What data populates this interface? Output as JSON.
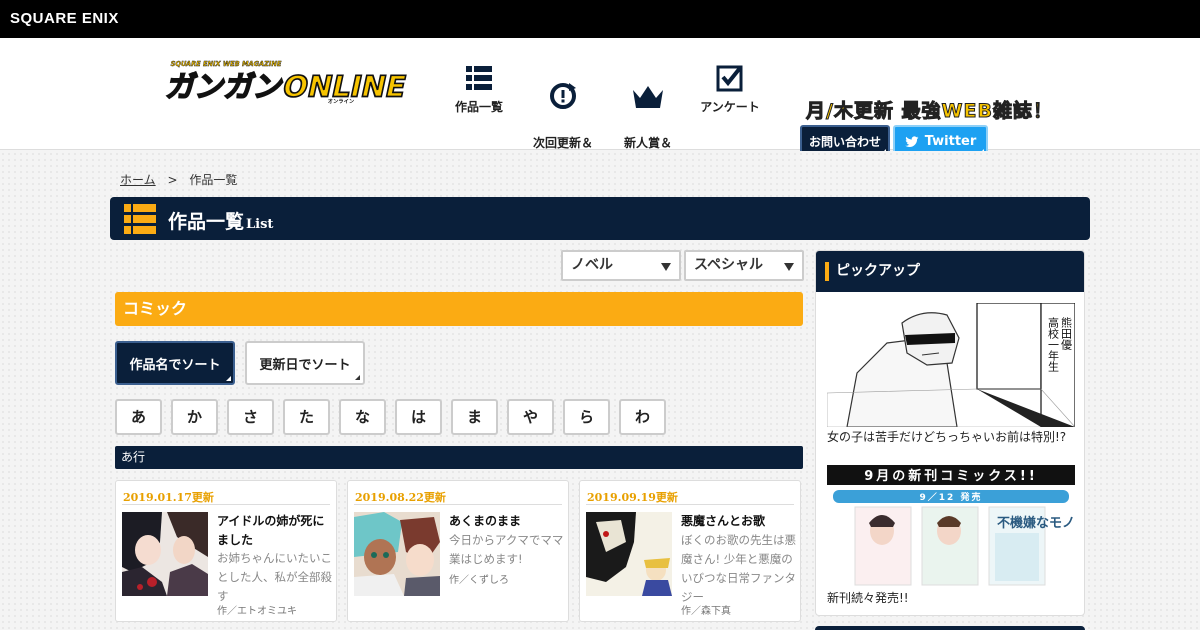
{
  "brand": {
    "name": "SQUARE ENIX"
  },
  "header": {
    "logo_top": "SQUARE ENIX WEB MAGAZINE",
    "logo_main": "ガンガンONLINE",
    "logo_sub": "オンライン",
    "nav": [
      {
        "label": "作品一覧",
        "icon": "list-icon"
      },
      {
        "label": "次回更新＆\n履歴",
        "icon": "refresh-clock-icon"
      },
      {
        "label": "新人賞＆\n持ち込み",
        "icon": "crown-icon"
      },
      {
        "label": "アンケート",
        "icon": "checkbox-icon"
      }
    ],
    "tagline": "月/木更新 最強WEB雑誌！",
    "contact_label": "お問い合わせ",
    "twitter_label": "Twitter"
  },
  "breadcrumb": {
    "home": "ホーム",
    "separator": ">",
    "current": "作品一覧"
  },
  "page_title": {
    "main": "作品一覧",
    "sub": "List"
  },
  "filters": {
    "novel": "ノベル",
    "special": "スペシャル"
  },
  "section": {
    "title": "コミック"
  },
  "sort": {
    "by_title": "作品名でソート",
    "by_date": "更新日でソート"
  },
  "kana": [
    "あ",
    "か",
    "さ",
    "た",
    "な",
    "は",
    "ま",
    "や",
    "ら",
    "わ"
  ],
  "row_heading": "あ行",
  "works": [
    {
      "date": "2019.01.17更新",
      "title": "アイドルの姉が死にました",
      "desc": "お姉ちゃんにいたいことした人、私が全部殺す",
      "author": "作／エトオミユキ"
    },
    {
      "date": "2019.08.22更新",
      "title": "あくまのまま",
      "desc": "今日からアクマでママ業はじめます!",
      "author": "作／くずしろ"
    },
    {
      "date": "2019.09.19更新",
      "title": "悪魔さんとお歌",
      "desc": "ぼくのお歌の先生は悪魔さん! 少年と悪魔のいびつな日常ファンタジー",
      "author": "作／森下真"
    }
  ],
  "sidebar": {
    "title": "ピックアップ",
    "pick_vertical_text": [
      "熊田優",
      "高校一年生"
    ],
    "pick_caption": "女の子は苦手だけどちっちゃいお前は特別!?",
    "new_banner_title": "9月の新刊コミックス!!",
    "new_banner_date": "9／12 発売",
    "new_banner_book": "不機嫌なモノノケ庵",
    "new_caption": "新刊続々発売!!"
  },
  "colors": {
    "navy": "#0a1f3a",
    "orange": "#fbab13",
    "twitter": "#1da1f2",
    "date": "#e8a000"
  }
}
